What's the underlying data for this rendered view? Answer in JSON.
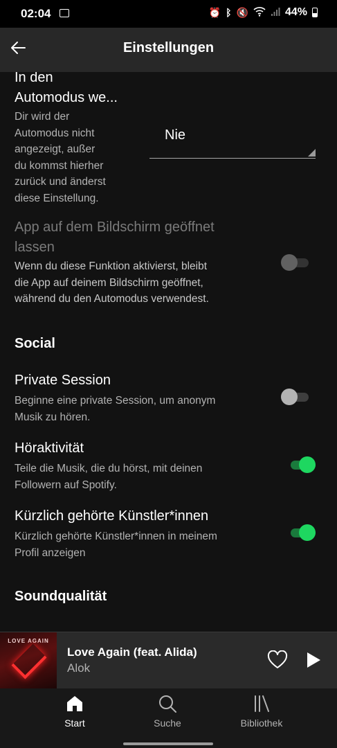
{
  "status_bar": {
    "time": "02:04",
    "battery": "44%"
  },
  "header": {
    "title": "Einstellungen"
  },
  "settings": {
    "automode": {
      "title_line1": "In den",
      "title_line2": "Automodus we...",
      "desc": [
        "Dir wird der",
        "Automodus nicht",
        "angezeigt, außer",
        "du kommst hierher",
        "zurück und änderst",
        "diese Einstellung."
      ],
      "dropdown_value": "Nie"
    },
    "keep_open": {
      "title_line1": "App auf dem Bildschirm geöffnet",
      "title_line2": "lassen",
      "desc": [
        "Wenn du diese Funktion aktivierst, bleibt",
        "die App auf deinem Bildschirm geöffnet,",
        "während du den Automodus verwendest."
      ],
      "enabled": false
    },
    "social_header": "Social",
    "private_session": {
      "title": "Private Session",
      "desc": [
        "Beginne eine private Session, um anonym",
        "Musik zu hören."
      ],
      "enabled": false
    },
    "listening_activity": {
      "title": "Höraktivität",
      "desc": [
        "Teile die Musik, die du hörst, mit deinen",
        "Followern auf Spotify."
      ],
      "enabled": true
    },
    "recent_artists": {
      "title": "Kürzlich gehörte Künstler*innen",
      "desc": [
        "Kürzlich gehörte Künstler*innen in meinem",
        "Profil anzeigen"
      ],
      "enabled": true
    },
    "sound_header": "Soundqualität"
  },
  "now_playing": {
    "title": "Love Again (feat. Alida)",
    "artist": "Alok",
    "cover_text": "LOVE AGAIN"
  },
  "nav": [
    {
      "label": "Start",
      "active": true
    },
    {
      "label": "Suche",
      "active": false
    },
    {
      "label": "Bibliothek",
      "active": false
    }
  ],
  "colors": {
    "accent": "#1ed760",
    "background": "#121212",
    "header": "#282828"
  }
}
